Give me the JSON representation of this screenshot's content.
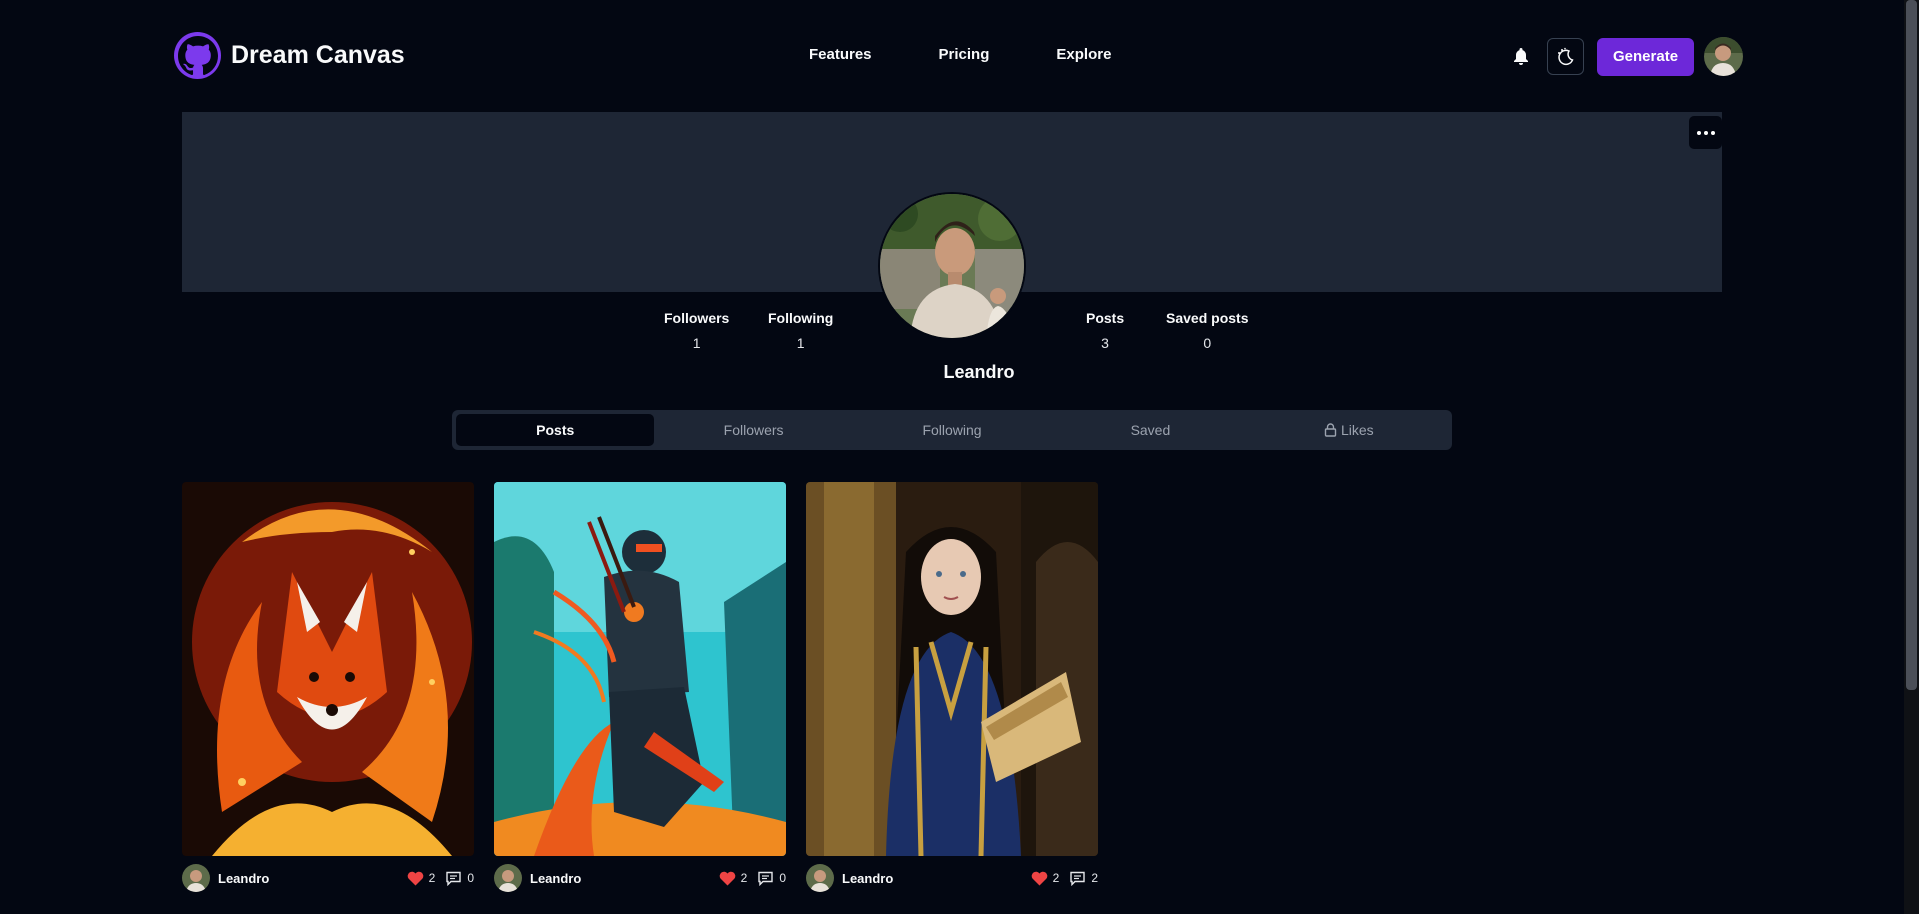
{
  "brand": {
    "name": "Dream Canvas",
    "logo_icon": "github-icon"
  },
  "nav": {
    "features": "Features",
    "pricing": "Pricing",
    "explore": "Explore"
  },
  "header": {
    "generate_label": "Generate",
    "bell_icon": "bell-icon",
    "theme_icon": "theme-toggle-icon"
  },
  "colors": {
    "accent": "#6d28d9",
    "background": "#030712",
    "panel": "#1e2635",
    "like": "#ef4444"
  },
  "profile": {
    "name": "Leandro",
    "stats": [
      {
        "label": "Followers",
        "value": "1"
      },
      {
        "label": "Following",
        "value": "1"
      },
      {
        "label": "Posts",
        "value": "3"
      },
      {
        "label": "Saved posts",
        "value": "0"
      }
    ]
  },
  "tabs": [
    {
      "label": "Posts",
      "active": true
    },
    {
      "label": "Followers",
      "active": false
    },
    {
      "label": "Following",
      "active": false
    },
    {
      "label": "Saved",
      "active": false
    },
    {
      "label": "Likes",
      "active": false,
      "icon": "lock-icon"
    }
  ],
  "posts": [
    {
      "author": "Leandro",
      "likes": "2",
      "comments": "0",
      "image": "fire-fox"
    },
    {
      "author": "Leandro",
      "likes": "2",
      "comments": "0",
      "image": "cyber-samurai"
    },
    {
      "author": "Leandro",
      "likes": "2",
      "comments": "2",
      "image": "woman-with-book"
    }
  ]
}
